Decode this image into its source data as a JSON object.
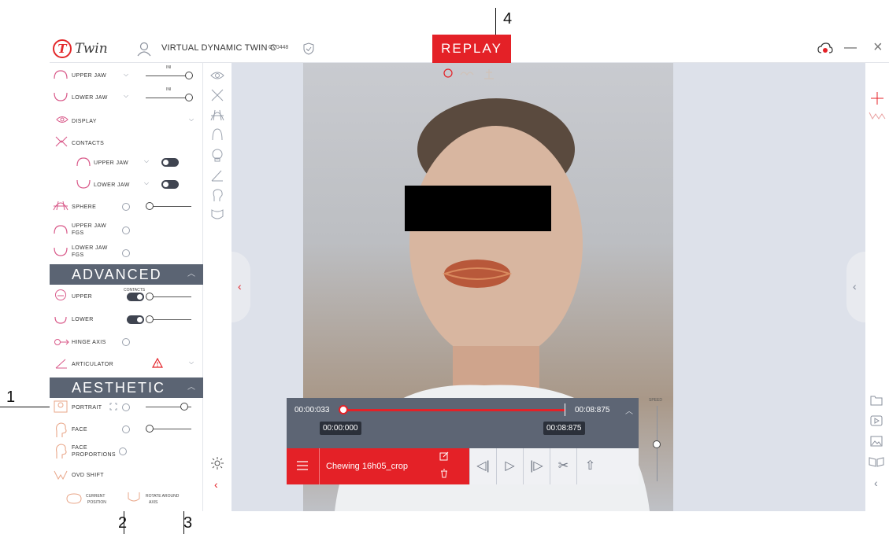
{
  "header": {
    "logo_letter": "T",
    "logo_text": "Twin",
    "patient_name": "VIRTUAL DYNAMIC TWIN C",
    "patient_id": "CV0448",
    "mode": "REPLAY",
    "close": "×",
    "minimize": "—"
  },
  "sidebar": {
    "upper_jaw": "UPPER JAW",
    "lower_jaw": "LOWER JAW",
    "ini": "INI",
    "display": "DISPLAY",
    "contacts": "CONTACTS",
    "sphere": "SPHERE",
    "upper_jaw_fgs_1": "UPPER JAW",
    "upper_jaw_fgs_2": "FGS",
    "lower_jaw_fgs_1": "LOWER JAW",
    "lower_jaw_fgs_2": "FGS",
    "advanced": "ADVANCED",
    "adv_contacts": "CONTACTS",
    "upper": "UPPER",
    "lower": "LOWER",
    "hinge_axis": "HINGE AXIS",
    "articulator": "ARTICULATOR",
    "aesthetic": "AESTHETIC",
    "portrait": "PORTRAIT",
    "face": "FACE",
    "face_prop_1": "FACE",
    "face_prop_2": "PROPORTIONS",
    "ovd_shift": "OVD SHIFT",
    "current_position_1": "CURRENT",
    "current_position_2": "POSITION",
    "rotate_axis_1": "ROTATE AROUND",
    "rotate_axis_2": "AXIS",
    "portrait_opacity": 0.9,
    "face_opacity": 0.2,
    "sphere_level": 0.1
  },
  "player": {
    "current_time": "00:00:033",
    "end_time": "00:08:875",
    "start_tag": "00:00:000",
    "end_tag": "00:08:875",
    "speed_label": "SPEED",
    "clip_name": "Chewing 16h05_crop",
    "progress": 0.0
  },
  "annotations": {
    "n1": "1",
    "n2": "2",
    "n3": "3",
    "n4": "4"
  },
  "colors": {
    "accent": "#e42127",
    "panel_dark": "#5b6473"
  }
}
